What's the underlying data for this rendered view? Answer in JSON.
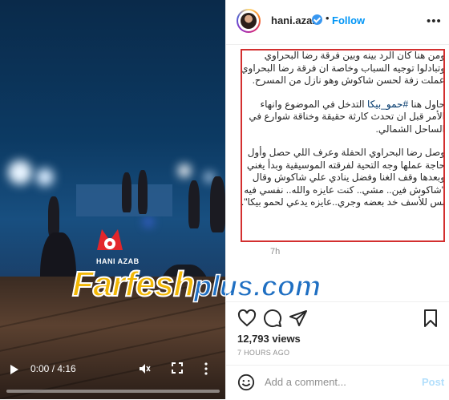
{
  "video": {
    "channel_name": "HANI AZAB",
    "time_display": "0:00 / 4:16",
    "progress": 0.0
  },
  "watermark": {
    "brand_a": "Farfesh",
    "brand_b": "plus.com"
  },
  "post": {
    "username": "hani.azab",
    "verified": true,
    "follow_label": "Follow",
    "caption_paragraphs": [
      "ومن هنا كان الرد بينه وبين فرقة رضا البحراوي وتبادلوا توجيه السباب وخاصة ان فرقة رضا البحراوي عملت زفة لحسن شاكوش وهو نازل من المسرح.",
      "حاول هنا",
      "وصل رضا البحراوي الحفلة وعرف اللي حصل وأول حاجة عملها وجه التحية لفرقته الموسيقية وبدأ يغني وبعدها وقف الغنا وفضل ينادي علي شاكوش وقال \"شاكوش فين.. مشي.. كنت عايزه والله.. نفسي فيه بس للأسف خد بعضه وجري..عايزه يدعي لحمو بيكا\"."
    ],
    "caption_p2_prefix": "حاول هنا ",
    "caption_hashtag": "#حمو_بيكا",
    "caption_p2_suffix": " التدخل في الموضوع وانهاء الأمر قبل ان تحدث كارثة حقيقة وخناقة شوارع في الساحل الشمالي.",
    "age": "7h",
    "views": "12,793 views",
    "timestamp": "7 HOURS AGO",
    "comment_placeholder": "Add a comment...",
    "post_label": "Post"
  },
  "colors": {
    "accent": "#0095f6",
    "highlight": "#d32f2f",
    "post_disabled": "#b2dffc"
  },
  "icons": [
    "heart-icon",
    "comment-icon",
    "share-icon",
    "bookmark-icon",
    "emoji-icon",
    "play-icon",
    "mute-icon",
    "fullscreen-icon",
    "more-options-icon",
    "verified-icon"
  ]
}
